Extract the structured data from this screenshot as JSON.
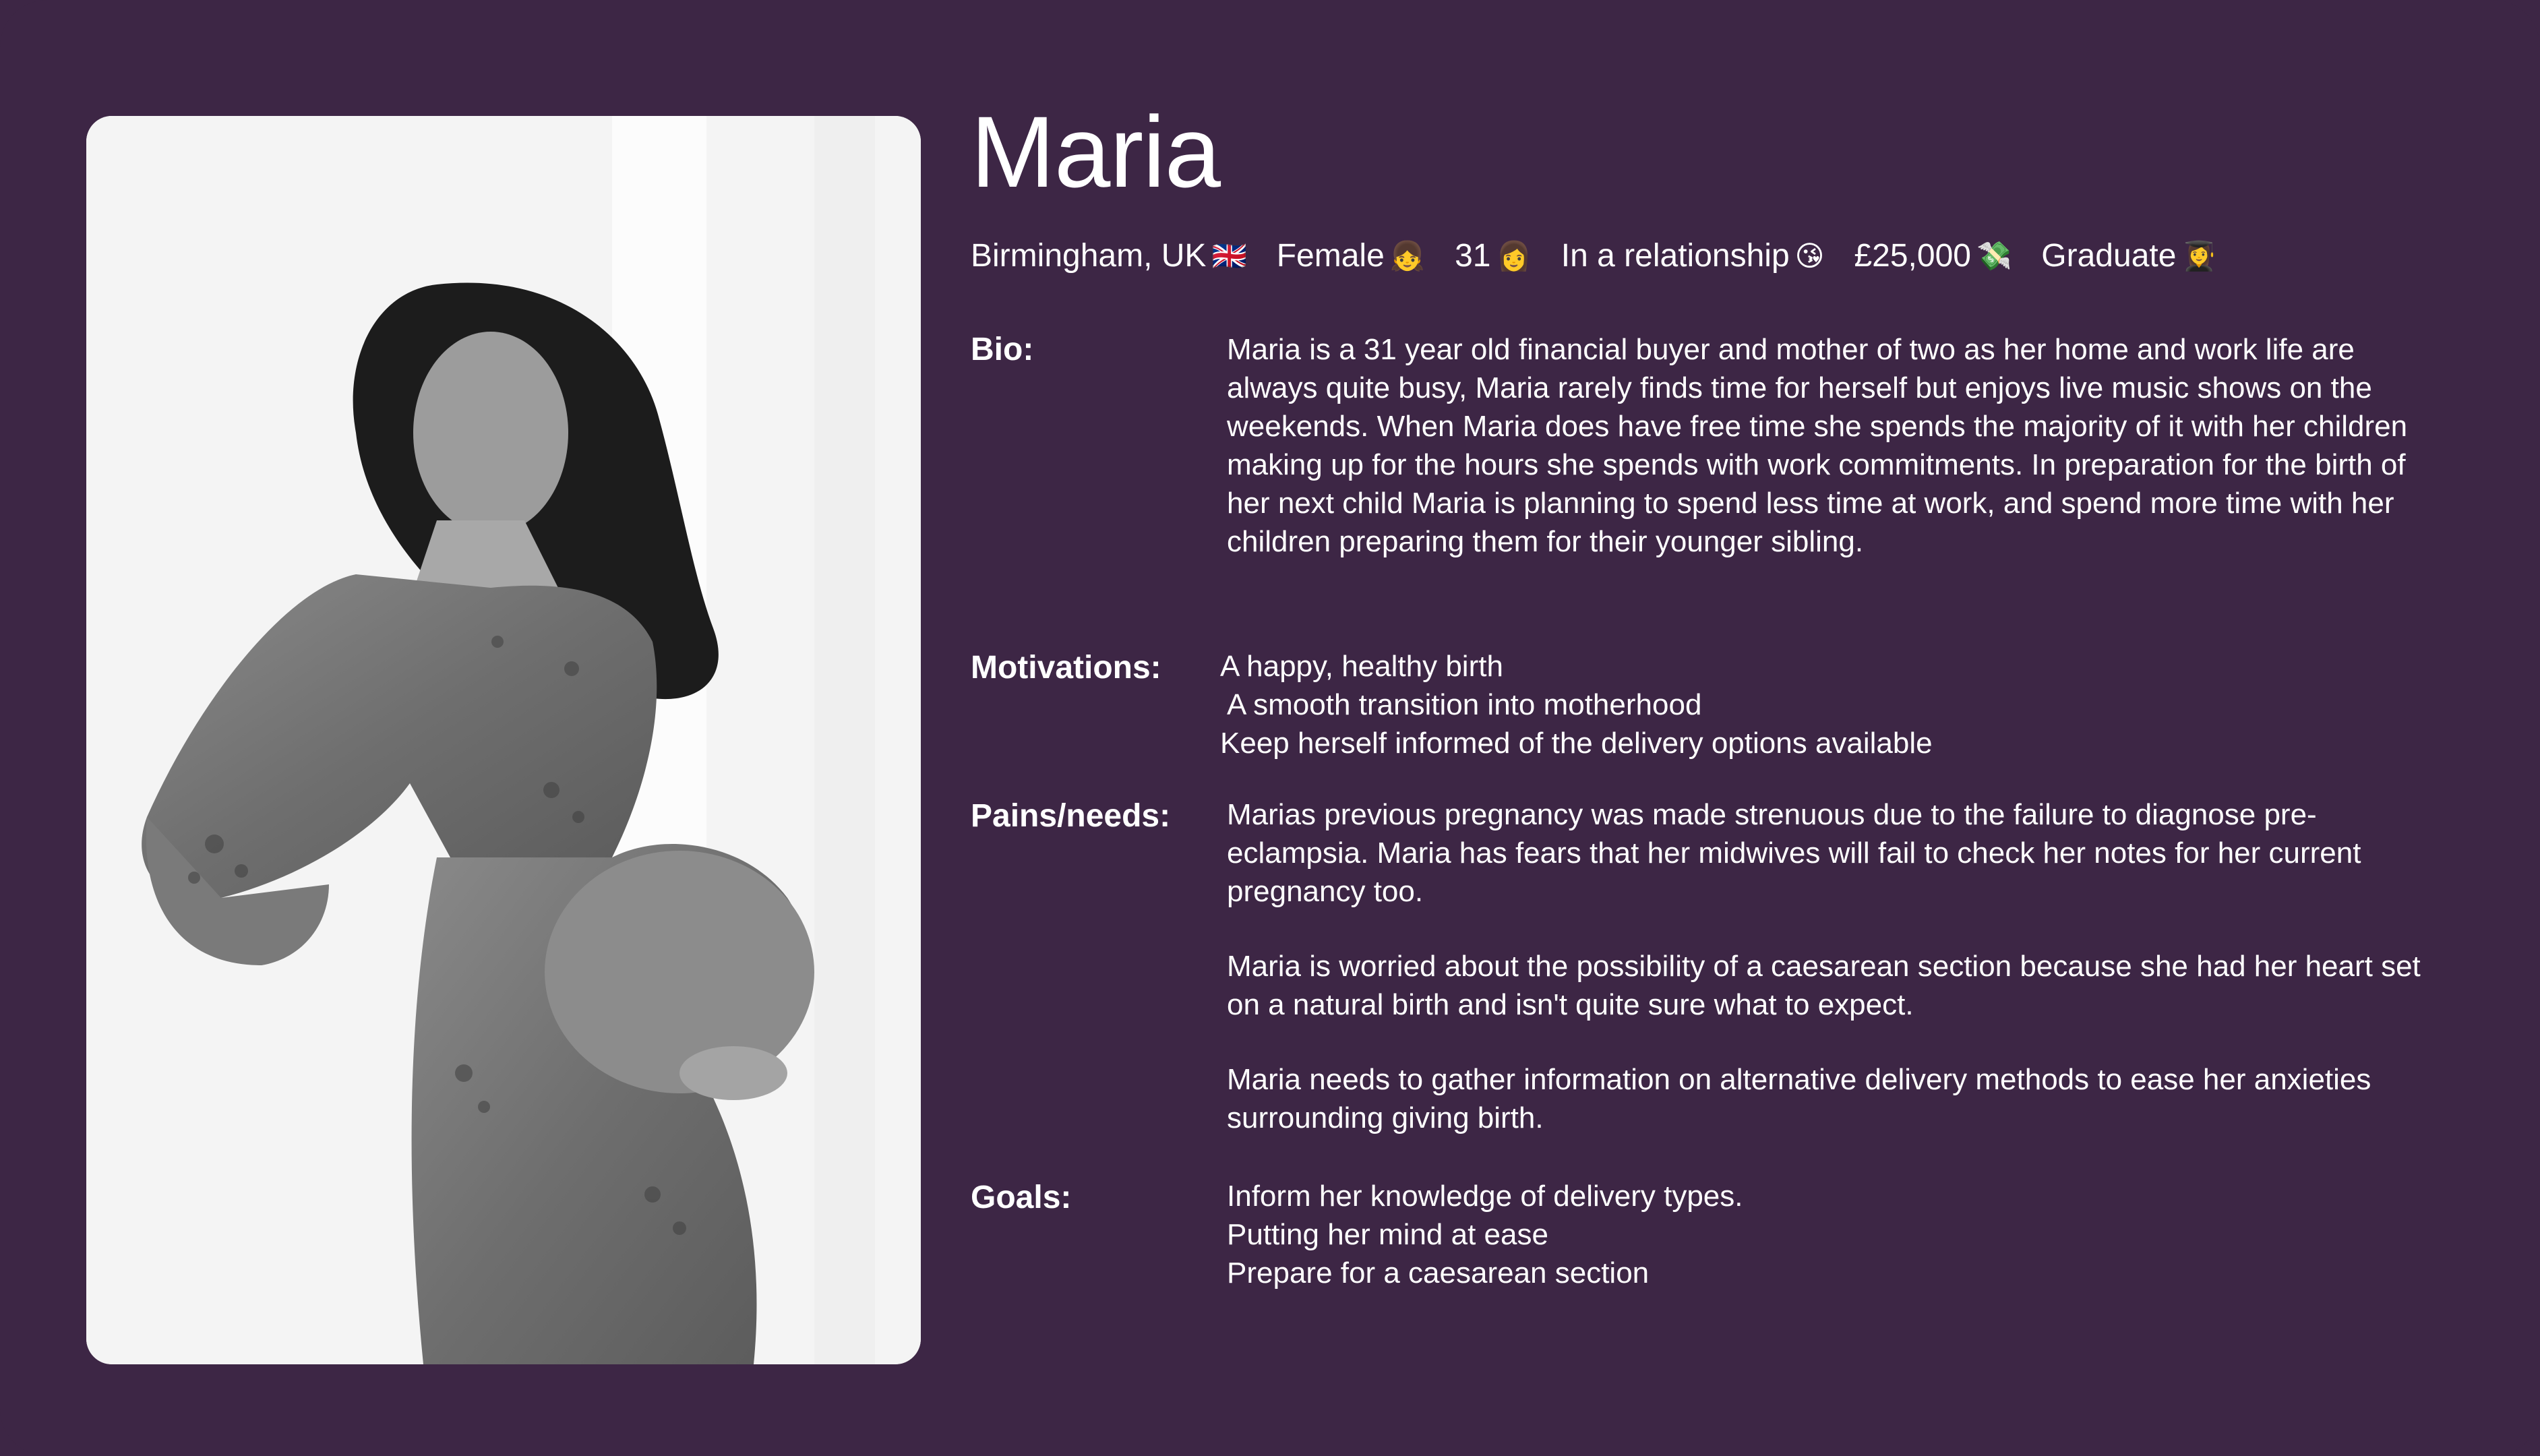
{
  "persona": {
    "name": "Maria",
    "meta": [
      {
        "text": "Birmingham, UK",
        "icon": "🇬🇧",
        "icon_name": "uk-flag-icon"
      },
      {
        "text": "Female",
        "icon": "👧",
        "icon_name": "girl-icon"
      },
      {
        "text": "31",
        "icon": "👩",
        "icon_name": "woman-icon"
      },
      {
        "text": "In a relationship",
        "icon": "😘",
        "icon_name": "kiss-face-icon"
      },
      {
        "text": "£25,000",
        "icon": "💸",
        "icon_name": "money-icon"
      },
      {
        "text": "Graduate",
        "icon": "👩‍🎓",
        "icon_name": "graduate-icon"
      }
    ]
  },
  "sections": {
    "bio": {
      "label": "Bio:",
      "text": "Maria is a 31 year old financial buyer and mother of two as her home and work life are always quite busy, Maria rarely finds time for herself but enjoys live music shows on the weekends. When Maria does have free time she spends the majority of it with her children making up for the hours she spends with work commitments. In preparation for the birth of her next child Maria is planning to spend less time at work, and spend more time with her children preparing them for their younger sibling."
    },
    "motivations": {
      "label": "Motivations:",
      "items": [
        "A happy, healthy birth",
        "A smooth transition into motherhood",
        "Keep herself informed of the delivery options available"
      ]
    },
    "pains": {
      "label": "Pains/needs:",
      "paragraphs": [
        "Marias previous pregnancy was made strenuous due to the failure to diagnose pre-eclampsia. Maria has fears that her midwives will fail to check her notes for her current pregnancy too.",
        "Maria is worried about the possibility of a caesarean section because she had her heart set on a natural birth and isn't quite sure what to expect.",
        "Maria needs to gather information on alternative delivery methods to ease her anxieties surrounding giving birth."
      ]
    },
    "goals": {
      "label": "Goals:",
      "items": [
        "Inform her knowledge of delivery types.",
        "Putting her mind at ease",
        "Prepare for a caesarean section"
      ]
    }
  },
  "colors": {
    "background": "#3d2645",
    "text": "#ffffff"
  }
}
